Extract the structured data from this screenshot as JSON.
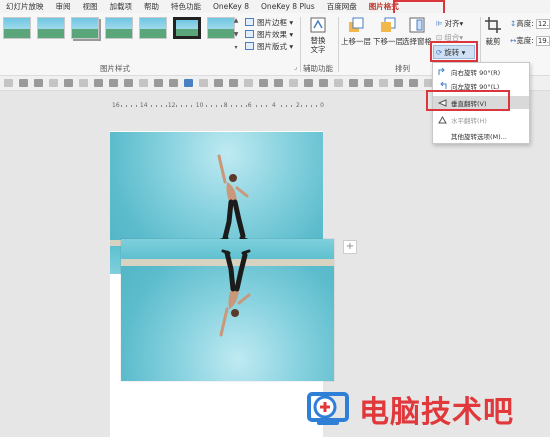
{
  "tabs": [
    {
      "label": "幻灯片放映",
      "active": false
    },
    {
      "label": "审阅",
      "active": false
    },
    {
      "label": "视图",
      "active": false
    },
    {
      "label": "加载项",
      "active": false
    },
    {
      "label": "帮助",
      "active": false
    },
    {
      "label": "特色功能",
      "active": false
    },
    {
      "label": "OneKey 8",
      "active": false
    },
    {
      "label": "OneKey 8 Plus",
      "active": false
    },
    {
      "label": "百度网盘",
      "active": false
    },
    {
      "label": "图片格式",
      "active": true
    }
  ],
  "ribbon": {
    "picture_options": [
      "图片边框",
      "图片效果",
      "图片版式"
    ],
    "group_picture_styles": "图片样式",
    "alt_text": "替换\n文字",
    "group_accessibility": "辅助功能",
    "bring_forward": "上移一层",
    "send_backward": "下移一层",
    "selection_pane": "选择窗格",
    "align": "对齐",
    "group_label": "组合",
    "rotate": "旋转",
    "group_arrange": "排列",
    "crop": "裁剪",
    "height_label": "高度:",
    "width_label": "宽度:",
    "height_value": "12.",
    "width_value": "19."
  },
  "rotate_menu": {
    "items": [
      {
        "label": "向右旋转 90°(R)",
        "state": "normal"
      },
      {
        "label": "向左旋转 90°(L)",
        "state": "normal"
      },
      {
        "label": "垂直翻转(V)",
        "state": "highlighted"
      },
      {
        "label": "水平翻转(H)",
        "state": "dim"
      },
      {
        "label": "其他旋转选项(M)...",
        "state": "normal"
      }
    ]
  },
  "ruler": {
    "labels": [
      "16",
      "14",
      "12",
      "10",
      "8",
      "6",
      "4",
      "2",
      "0"
    ]
  },
  "canvas": {
    "plus": "+"
  },
  "watermark": {
    "text": "电脑技术吧"
  },
  "colors": {
    "accent_red": "#d9363e",
    "tab_active": "#c0392b",
    "watermark": "#e0383b"
  }
}
